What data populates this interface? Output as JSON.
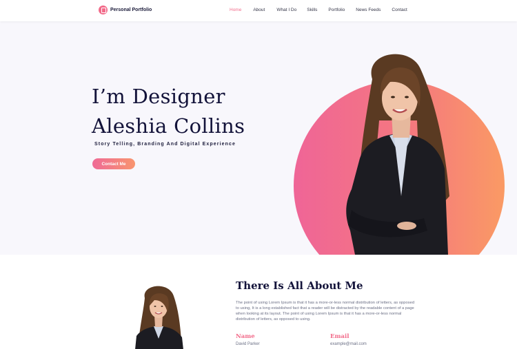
{
  "nav": {
    "logo_text": "Personal Portfolio",
    "items": [
      "Home",
      "About",
      "What I Do",
      "Skills",
      "Portfolio",
      "News Feeds",
      "Contact"
    ],
    "active": "Home"
  },
  "hero": {
    "line1": "I’m Designer",
    "line2": "Aleshia Collins",
    "subtitle": "Story Telling, Branding And Digital Experience",
    "button": "Contact Me"
  },
  "about": {
    "title": "There Is All About Me",
    "body": "The point of using Lorem Ipsum is that it has a more-or-less normal distribution of letters, as opposed to using, It is a long established fact that a reader will be distracted by the readable content of a page when looking at its layout. The point of using Lorem Ipsum is that it has a more-or-less normal distribution of letters, as opposed to using.",
    "name_label": "Name",
    "name_value": "David Parker",
    "email_label": "Email",
    "email_value": "example@mail.com"
  },
  "colors": {
    "accent": "#f26b8a",
    "gradient_start": "#ef6597",
    "gradient_end": "#fa9a64",
    "heading": "#13133a"
  }
}
